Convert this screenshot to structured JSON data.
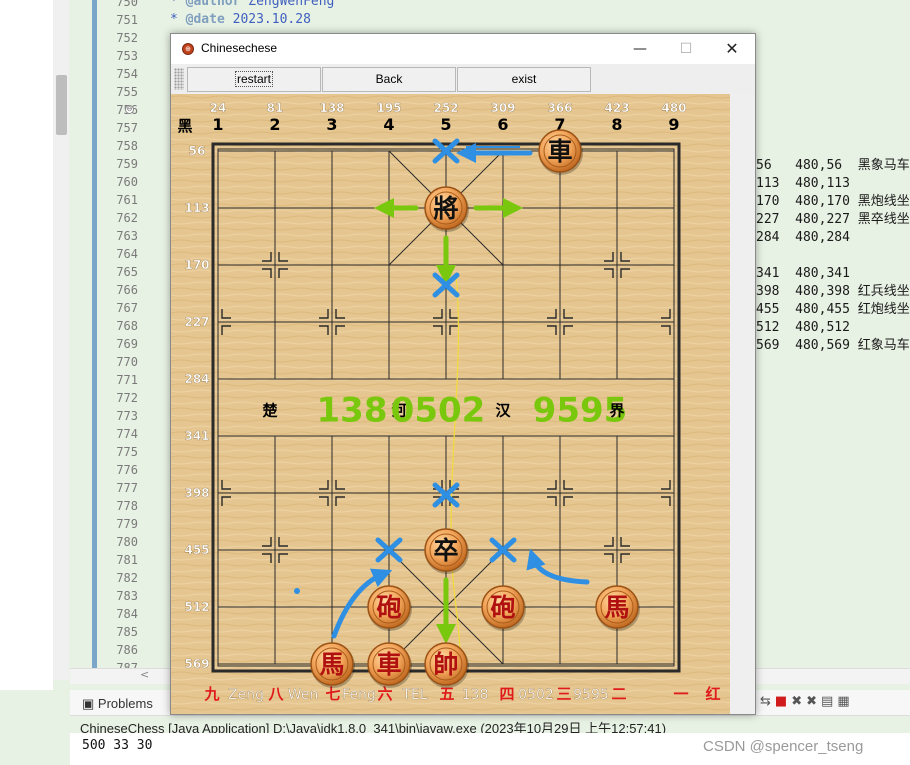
{
  "ide": {
    "line_numbers": [
      "750",
      "751",
      "752",
      "753",
      "754",
      "755",
      "756",
      "757",
      "758",
      "759",
      "760",
      "761",
      "762",
      "763",
      "764",
      "765",
      "766",
      "767",
      "768",
      "769",
      "770",
      "771",
      "772",
      "773",
      "774",
      "775",
      "776",
      "777",
      "778",
      "779",
      "780",
      "781",
      "782",
      "783",
      "784",
      "785",
      "786",
      "787"
    ],
    "fold_symbol": "⊖",
    "code": [
      {
        "prefix": "* ",
        "tag": "@author",
        "text": " ZengWenFeng"
      },
      {
        "prefix": "* ",
        "tag": "@date",
        "text": " 2023.10.28"
      }
    ],
    "right_code": [
      "56   480,56  黑象马车",
      "113  480,113",
      "170  480,170 黑炮线坐",
      "227  480,227 黑卒线坐",
      "284  480,284",
      "",
      "341  480,341",
      "398  480,398 红兵线坐",
      "455  480,455 红炮线坐",
      "512  480,512",
      "569  480,569 红象马车"
    ],
    "problems_tab": "Problems",
    "console_header": "ChineseChess [Java Application] D:\\Java\\jdk1.8.0_341\\bin\\javaw.exe (2023年10月29日 上午12:57:41)",
    "console_output": "500 33 30",
    "watermark": "CSDN @spencer_tseng"
  },
  "window": {
    "title": "Chinesechese",
    "minimize": "—",
    "maximize": "☐",
    "close": "✕",
    "buttons": {
      "restart": "restart",
      "back": "Back",
      "exist": "exist"
    }
  },
  "board": {
    "top_coords": [
      "24",
      "81",
      "138",
      "195",
      "252",
      "309",
      "366",
      "423",
      "480"
    ],
    "left_coords": [
      "56",
      "113",
      "170",
      "227",
      "284",
      "341",
      "398",
      "455",
      "512",
      "569"
    ],
    "black_label": "黑",
    "top_cols": [
      "1",
      "2",
      "3",
      "4",
      "5",
      "6",
      "7",
      "8",
      "9"
    ],
    "river": [
      "楚",
      "138",
      "河",
      "0502",
      "汉",
      "9595",
      "界"
    ],
    "bottom_row": [
      {
        "text": "九",
        "red": true
      },
      {
        "text": "Zeng",
        "red": false
      },
      {
        "text": "八",
        "red": true
      },
      {
        "text": "Wen",
        "red": false
      },
      {
        "text": "七",
        "red": true
      },
      {
        "text": "Feng",
        "red": false
      },
      {
        "text": "六",
        "red": true
      },
      {
        "text": "TEL",
        "red": false
      },
      {
        "text": "五",
        "red": true
      },
      {
        "text": "138",
        "red": false
      },
      {
        "text": "四",
        "red": true
      },
      {
        "text": "0502",
        "red": false
      },
      {
        "text": "三",
        "red": true
      },
      {
        "text": "9595",
        "red": false
      },
      {
        "text": "二",
        "red": true
      },
      {
        "text": "一",
        "red": true
      },
      {
        "text": "红",
        "red": true
      }
    ],
    "pieces": [
      {
        "char": "車",
        "side": "black",
        "col": 7,
        "row": 1
      },
      {
        "char": "將",
        "side": "black",
        "col": 5,
        "row": 2
      },
      {
        "char": "卒",
        "side": "black",
        "col": 5,
        "row": 8
      },
      {
        "char": "砲",
        "side": "red",
        "col": 4,
        "row": 9
      },
      {
        "char": "砲",
        "side": "red",
        "col": 6,
        "row": 9
      },
      {
        "char": "馬",
        "side": "red",
        "col": 8,
        "row": 9
      },
      {
        "char": "馬",
        "side": "red",
        "col": 3,
        "row": 10
      },
      {
        "char": "車",
        "side": "red",
        "col": 4,
        "row": 10
      },
      {
        "char": "帥",
        "side": "red",
        "col": 5,
        "row": 10
      }
    ],
    "colors": {
      "wood": "#e6c690",
      "line": "#2a2a2a",
      "red_text": "#e01a1a",
      "black_piece_text": "#111111",
      "red_piece_text": "#b01010",
      "annotation_blue": "#2f8fe3",
      "annotation_green": "#79c80e",
      "coord_white": "#ffffff"
    }
  }
}
